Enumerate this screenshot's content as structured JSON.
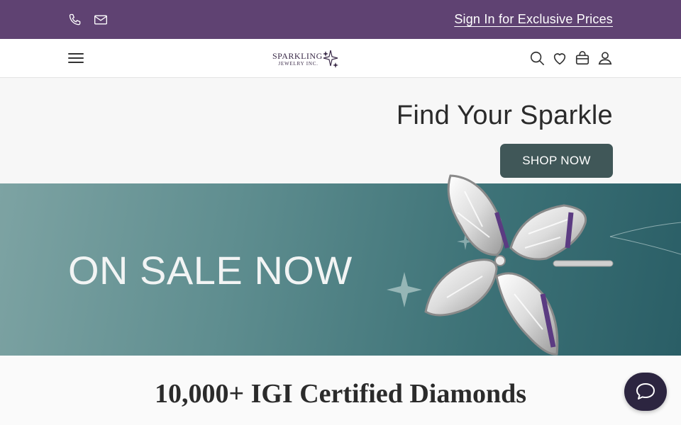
{
  "topbar": {
    "signin_label": "Sign In for Exclusive Prices",
    "background": "#5f4272",
    "icons": [
      "phone-icon",
      "mail-icon"
    ]
  },
  "navbar": {
    "logo": {
      "line1": "SPARKLING",
      "line2": "JEWELRY INC."
    },
    "icons": [
      "menu-icon",
      "search-icon",
      "heart-icon",
      "bag-icon",
      "user-icon"
    ]
  },
  "hero": {
    "title": "Find Your Sparkle",
    "cta_label": "SHOP NOW",
    "cta_color": "#405758",
    "banner_text": "ON SALE NOW"
  },
  "section": {
    "title": "10,000+ IGI Certified Diamonds"
  },
  "chat": {
    "icon": "chat-bubble-icon",
    "color": "#2c2540"
  }
}
